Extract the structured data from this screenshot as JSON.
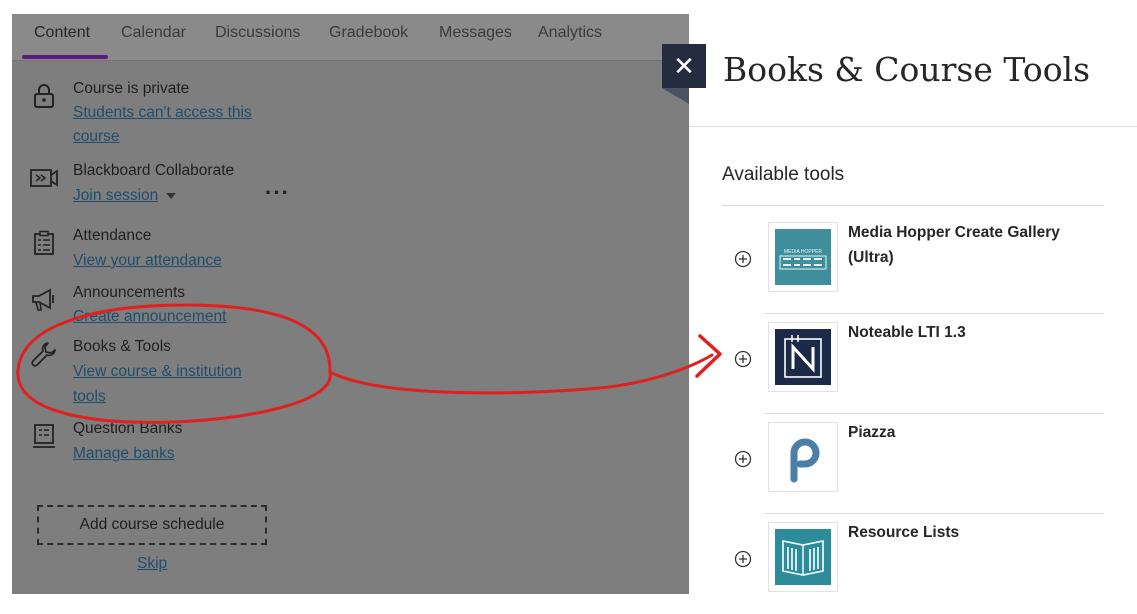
{
  "tabs": [
    {
      "label": "Content",
      "active": true
    },
    {
      "label": "Calendar"
    },
    {
      "label": "Discussions"
    },
    {
      "label": "Gradebook"
    },
    {
      "label": "Messages"
    },
    {
      "label": "Analytics"
    }
  ],
  "course_items": {
    "privacy": {
      "title": "Course is private",
      "link_line1": "Students can't access this",
      "link_line2": "course",
      "icon": "lock-icon"
    },
    "collaborate": {
      "title": "Blackboard Collaborate",
      "link": "Join session",
      "icon": "video-collaborate-icon"
    },
    "attendance": {
      "title": "Attendance",
      "link": "View your attendance",
      "icon": "clipboard-icon"
    },
    "announcements": {
      "title": "Announcements",
      "link": "Create announcement",
      "icon": "megaphone-icon"
    },
    "books_tools": {
      "title": "Books & Tools",
      "link_line1": "View course & institution",
      "link_line2": "tools",
      "icon": "wrench-icon"
    },
    "question_banks": {
      "title": "Question Banks",
      "link": "Manage banks",
      "icon": "question-bank-icon"
    }
  },
  "schedule": {
    "button": "Add course schedule",
    "skip": "Skip"
  },
  "panel": {
    "title": "Books & Course Tools",
    "close_icon": "close-icon",
    "section_label": "Available tools",
    "tools": [
      {
        "name_line1": "Media Hopper Create Gallery",
        "name_line2": "(Ultra)",
        "logo": "media-hopper-create-logo"
      },
      {
        "name_line1": "Noteable LTI 1.3",
        "logo": "noteable-logo"
      },
      {
        "name_line1": "Piazza",
        "logo": "piazza-logo"
      },
      {
        "name_line1": "Resource Lists",
        "logo": "resource-lists-logo"
      }
    ]
  },
  "colors": {
    "overlay": "#7e7e7e",
    "active_tab_underline": "#5a1f7a",
    "annotation_red": "#e02020",
    "close_button": "#262c3f",
    "link": "#1f4d6b"
  }
}
